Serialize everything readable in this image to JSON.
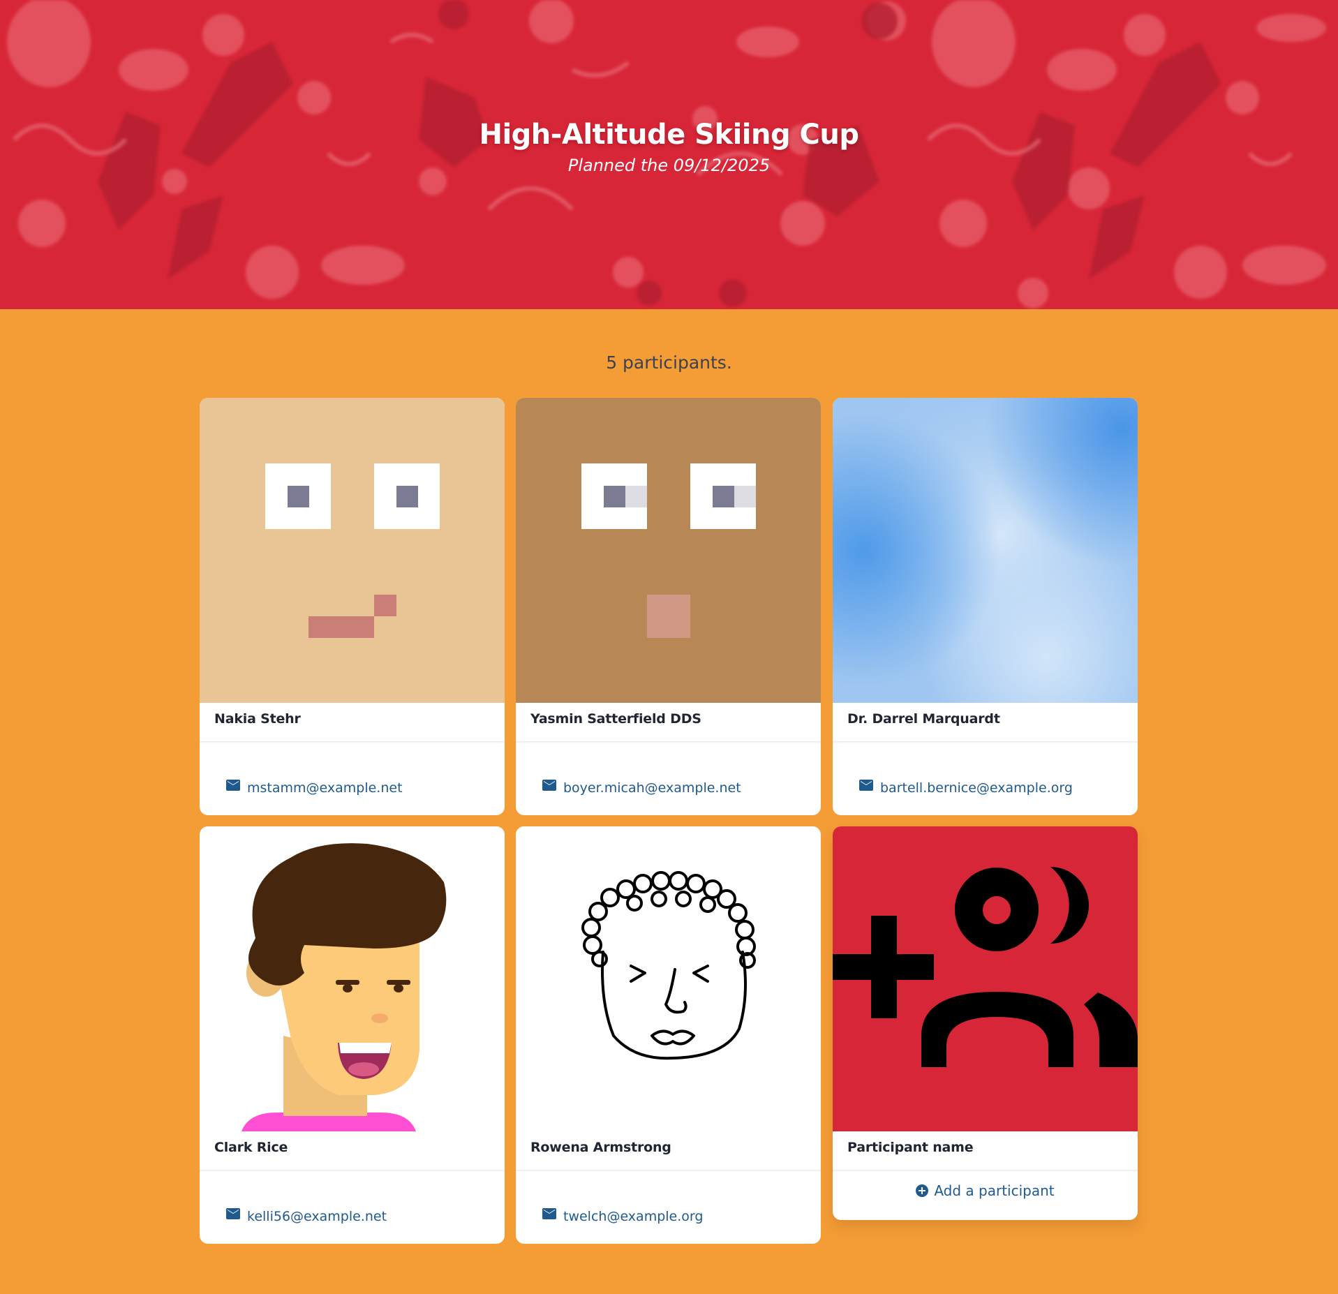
{
  "colors": {
    "hero_background": "#d72638",
    "page_background": "#f49d37",
    "link": "#1f5a8e",
    "card_background": "#ffffff"
  },
  "event": {
    "title": "High-Altitude Skiing Cup",
    "subtitle": "Planned the 09/12/2025"
  },
  "participants_count_text": "5 participants.",
  "participants": [
    {
      "name": "Nakia Stehr",
      "email": "mstamm@example.net",
      "avatar": "pixel-face-light"
    },
    {
      "name": "Yasmin Satterfield DDS",
      "email": "boyer.micah@example.net",
      "avatar": "pixel-face-tan"
    },
    {
      "name": "Dr. Darrel Marquardt",
      "email": "bartell.bernice@example.org",
      "avatar": "blue-gradient"
    },
    {
      "name": "Clark Rice",
      "email": "kelli56@example.net",
      "avatar": "cartoon-man"
    },
    {
      "name": "Rowena Armstrong",
      "email": "twelch@example.org",
      "avatar": "line-drawing-face"
    }
  ],
  "add_card": {
    "name_label": "Participant name",
    "add_label": "Add a participant",
    "icon": "add-user-icon"
  },
  "icons": {
    "email": "envelope-icon",
    "add": "plus-circle-icon"
  }
}
